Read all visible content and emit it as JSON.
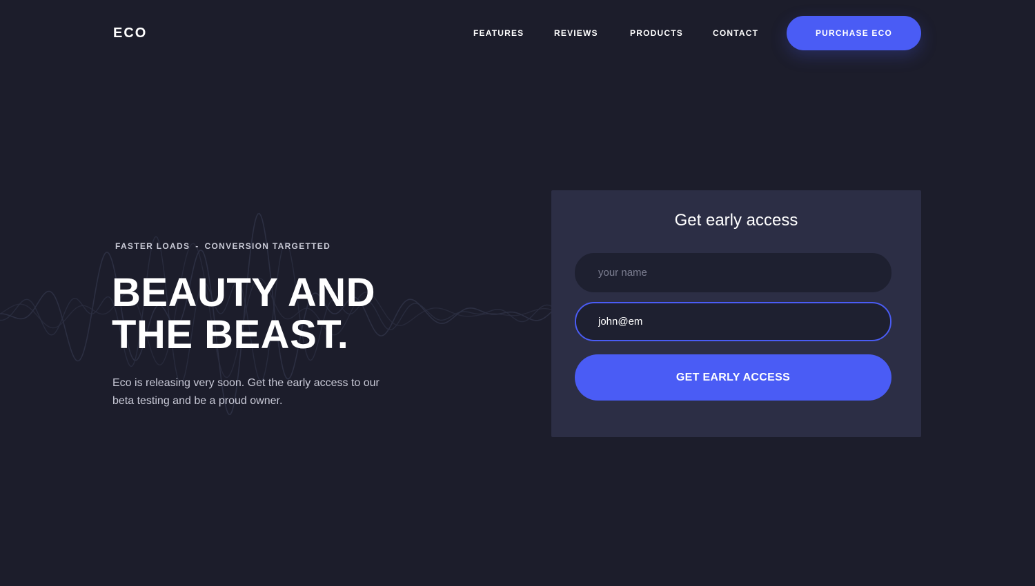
{
  "header": {
    "logo": "ECO",
    "nav": [
      "FEATURES",
      "REVIEWS",
      "PRODUCTS",
      "CONTACT"
    ],
    "cta_label": "PURCHASE ECO"
  },
  "hero": {
    "tagline": {
      "part1": "FASTER LOADS",
      "separator": "-",
      "part2": "CONVERSION TARGETTED"
    },
    "headline": {
      "line1": "BEAUTY AND",
      "line2": "THE BEAST."
    },
    "description": "Eco is releasing very soon. Get the early access to our beta testing and be a proud owner."
  },
  "signup": {
    "title": "Get early access",
    "name_field": {
      "placeholder": "your name",
      "value": ""
    },
    "email_field": {
      "placeholder": "",
      "value": "john@em"
    },
    "submit_label": "GET EARLY ACCESS"
  },
  "colors": {
    "background": "#1c1d2b",
    "card": "#2c2e45",
    "accent": "#4a5cf5",
    "input": "#1e2030",
    "wave": "#2c2f42"
  },
  "icons": {
    "background": "waveform-icon"
  }
}
